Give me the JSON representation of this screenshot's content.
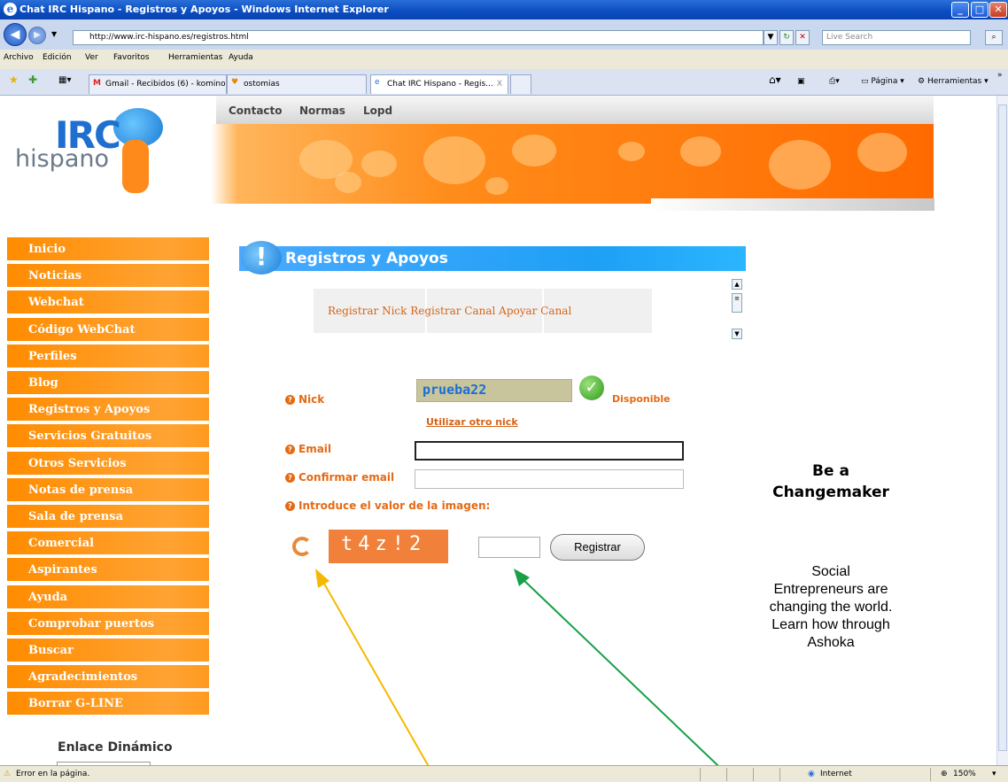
{
  "window": {
    "title": "Chat IRC Hispano - Registros y Apoyos - Windows Internet Explorer",
    "url": "http://www.irc-hispano.es/registros.html",
    "search_placeholder": "Live Search"
  },
  "menu": [
    "Archivo",
    "Edición",
    "Ver",
    "Favoritos",
    "Herramientas",
    "Ayuda"
  ],
  "tabs": [
    {
      "label": "Gmail - Recibidos (6) - komino..."
    },
    {
      "label": "ostomias"
    },
    {
      "label": "Chat IRC Hispano - Regis...",
      "close": "X"
    }
  ],
  "toolbar": {
    "pagina": "Página",
    "herramientas": "Herramientas"
  },
  "header": {
    "nav": [
      "Contacto",
      "Normas",
      "Lopd"
    ],
    "logo_irc": "IRC",
    "logo_hispano": "hispano"
  },
  "sidebar": {
    "items": [
      "Inicio",
      "Noticias",
      "Webchat",
      "Código WebChat",
      "Perfiles",
      "Blog",
      "Registros y Apoyos",
      "Servicios Gratuitos",
      "Otros Servicios",
      "Notas de prensa",
      "Sala de prensa",
      "Comercial",
      "Aspirantes",
      "Ayuda",
      "Comprobar puertos",
      "Buscar",
      "Agradecimientos",
      "Borrar G-LINE"
    ],
    "enlace": "Enlace Dinámico"
  },
  "content": {
    "heading": "Registros y Apoyos",
    "subtabs": "Registrar Nick Registrar Canal Apoyar Canal",
    "nick_label": "Nick",
    "nick_value": "prueba22",
    "disponible": "Disponible",
    "otro_nick": "Utilizar otro nick",
    "email_label": "Email",
    "confirm_label": "Confirmar email",
    "captcha_label": "Introduce el valor de la imagen:",
    "captcha_text": "t4z!2",
    "register_button": "Registrar"
  },
  "ad": {
    "headline1": "Be a",
    "headline2": "Changemaker",
    "body": "Social Entrepreneurs are changing the world. Learn how through Ashoka"
  },
  "status": {
    "error": "Error en la página.",
    "zone": "Internet",
    "zoom": "150%"
  },
  "colors": {
    "orange": "#ff8c00",
    "blue": "#1ea0f5",
    "label_orange": "#e46a14"
  }
}
